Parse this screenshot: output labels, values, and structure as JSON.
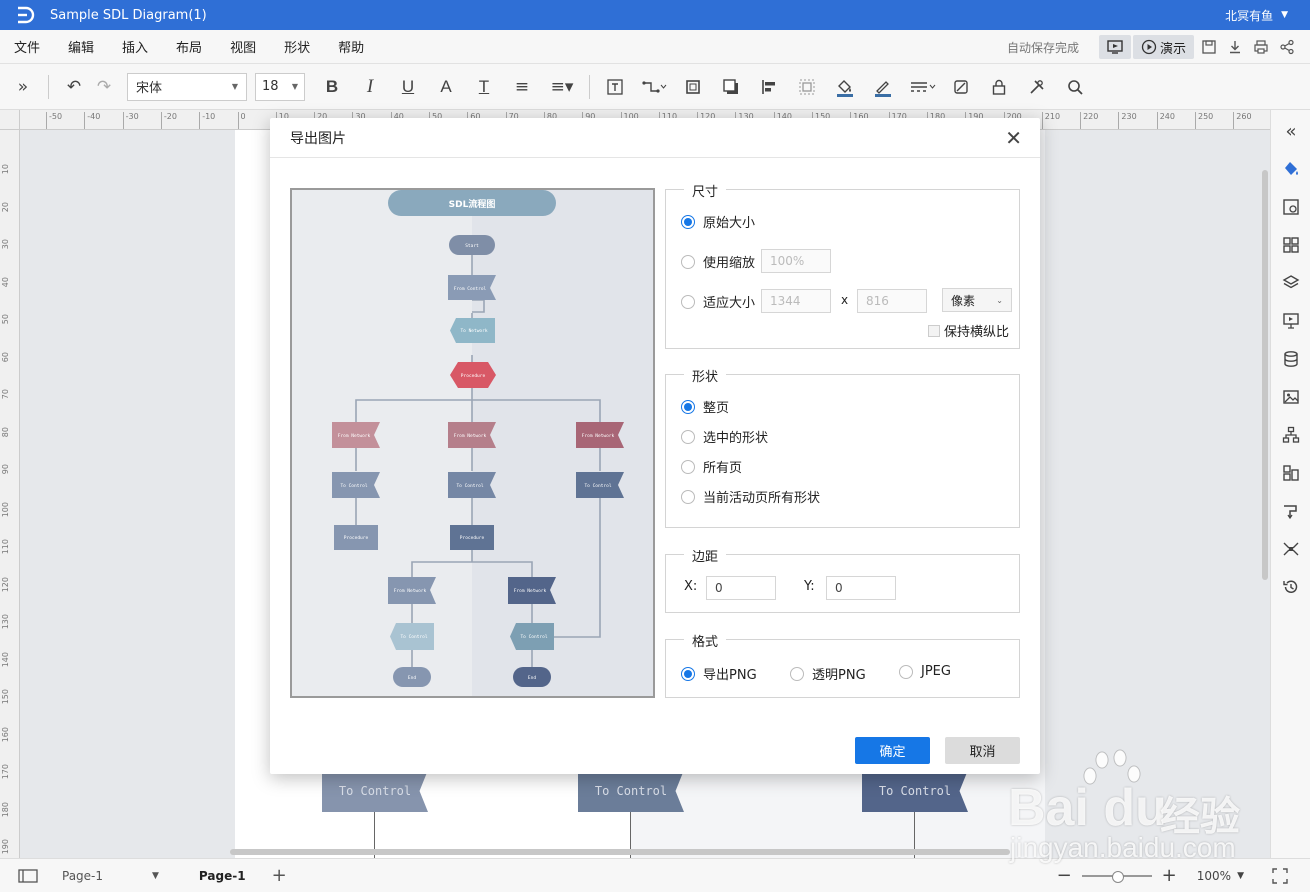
{
  "titlebar": {
    "title": "Sample SDL Diagram(1)",
    "user": "北冥有鱼"
  },
  "menu": {
    "items": [
      "文件",
      "编辑",
      "插入",
      "布局",
      "视图",
      "形状",
      "帮助"
    ],
    "autosave": "自动保存完成",
    "present": "演示"
  },
  "toolbar": {
    "font": "宋体",
    "size": "18"
  },
  "ruler": {
    "h_ticks": [
      "-50",
      "-40",
      "-30",
      "-20",
      "-10",
      "0",
      "10",
      "20",
      "30",
      "40",
      "50",
      "60",
      "70",
      "80",
      "90",
      "100",
      "110",
      "120",
      "130",
      "140",
      "150",
      "160",
      "170",
      "180",
      "190",
      "200",
      "210",
      "220",
      "230",
      "240",
      "250",
      "260"
    ],
    "v_ticks": [
      "10",
      "20",
      "30",
      "40",
      "50",
      "60",
      "70",
      "80",
      "90",
      "100",
      "110",
      "120",
      "130",
      "140",
      "150",
      "160",
      "170",
      "180",
      "190"
    ]
  },
  "canvas": {
    "bg_labels": [
      "To Control",
      "To Control",
      "To Control"
    ]
  },
  "statusbar": {
    "page_dropdown": "Page-1",
    "page_tab": "Page-1",
    "zoom": "100%"
  },
  "dialog": {
    "title": "导出图片",
    "size": {
      "title": "尺寸",
      "original": "原始大小",
      "scale": "使用缩放",
      "scale_value": "100%",
      "fit": "适应大小",
      "width": "1344",
      "x": "x",
      "height": "816",
      "unit": "像素",
      "keep_ratio": "保持横纵比",
      "selected": "original"
    },
    "shape": {
      "title": "形状",
      "options": [
        "整页",
        "选中的形状",
        "所有页",
        "当前活动页所有形状"
      ],
      "selected": 0
    },
    "margin": {
      "title": "边距",
      "x_label": "X:",
      "x_value": "0",
      "y_label": "Y:",
      "y_value": "0"
    },
    "format": {
      "title": "格式",
      "options": [
        "导出PNG",
        "透明PNG",
        "JPEG"
      ],
      "selected": 0
    },
    "ok": "确定",
    "cancel": "取消",
    "preview": {
      "title": "SDL流程图",
      "nodes": [
        "Start",
        "From Control",
        "To Network",
        "Procedure",
        "From Network",
        "From Network",
        "From Network",
        "To Control",
        "To Control",
        "To Control",
        "Procedure",
        "Procedure",
        "From Network",
        "From Network",
        "To Control",
        "To Control",
        "End",
        "End"
      ]
    }
  },
  "watermark": {
    "brand": "Bai du",
    "cn": "经验",
    "url": "jingyan.baidu.com"
  },
  "colors": {
    "accent": "#1677e6",
    "titlebar": "#2f6fd6"
  }
}
